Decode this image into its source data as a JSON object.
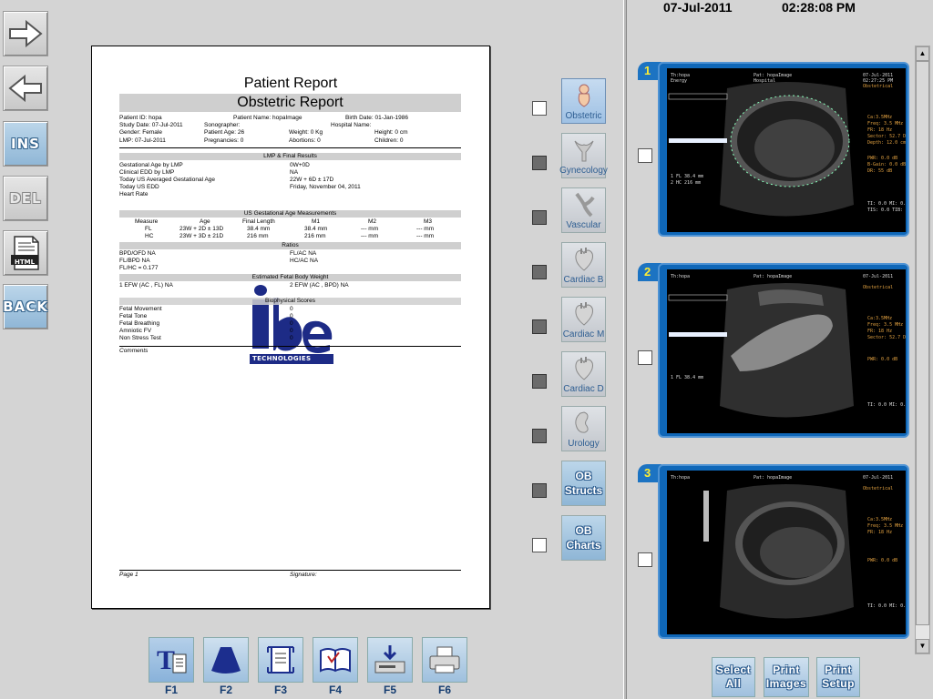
{
  "left_toolbar": {
    "forward_label": "",
    "back_arrow_label": "",
    "ins_label": "INS",
    "del_label": "DEL",
    "html_label": "HTML",
    "back_label": "BACK"
  },
  "report": {
    "title": "Patient Report",
    "subtitle": "Obstetric Report",
    "patient": {
      "patient_id": "Patient ID: hopa",
      "patient_name": "Patient Name: hopaImage",
      "birth_date": "Birth Date: 01-Jan-1986",
      "study_date": "Study Date: 07-Jul-2011",
      "sonographer": "Sonographer:",
      "hospital_name": "Hospital Name:",
      "gender": "Gender: Female",
      "patient_age": "Patient Age: 26",
      "weight": "Weight: 0 Kg",
      "height": "Height: 0 cm",
      "lmp": "LMP: 07-Jul-2011",
      "pregnancies": "Pregnancies: 0",
      "abortions": "Abortions: 0",
      "children": "Children: 0"
    },
    "lmp_section": {
      "header": "LMP & Final Results",
      "rows": [
        {
          "label": "Gestational Age by LMP",
          "value": "0W+0D"
        },
        {
          "label": "Clinical EDD by LMP",
          "value": "NA"
        },
        {
          "label": "Today US Averaged Gestational Age",
          "value": "22W + 6D ± 17D"
        },
        {
          "label": "Today US EDD",
          "value": "Friday, November 04, 2011"
        },
        {
          "label": "Heart Rate",
          "value": ""
        }
      ]
    },
    "us_section": {
      "header": "US Gestational Age Measurements",
      "columns": [
        "Measure",
        "Age",
        "Final Length",
        "M1",
        "M2",
        "M3"
      ],
      "rows": [
        [
          "FL",
          "23W + 2D ± 13D",
          "38.4 mm",
          "38.4 mm",
          "--- mm",
          "--- mm"
        ],
        [
          "HC",
          "23W + 3D ± 21D",
          "216 mm",
          "216 mm",
          "--- mm",
          "--- mm"
        ]
      ]
    },
    "ratios": {
      "header": "Ratios",
      "left": [
        "BPD/OFD NA",
        "FL/BPD NA",
        "FL/HC = 0.177"
      ],
      "right": [
        "FL/AC NA",
        "HC/AC NA"
      ]
    },
    "efw": {
      "header": "Estimated Fetal Body Weight",
      "left": "1 EFW (AC , FL) NA",
      "right": "2 EFW (AC , BPD) NA"
    },
    "biophysical": {
      "header": "Biophysical Scores",
      "rows": [
        {
          "label": "Fetal Movement",
          "value": "0"
        },
        {
          "label": "Fetal Tone",
          "value": "0"
        },
        {
          "label": "Fetal Breathing",
          "value": "0"
        },
        {
          "label": "Amniotic FV",
          "value": "0"
        },
        {
          "label": "Non Stress Test",
          "value": "0"
        }
      ]
    },
    "comments": "Comments",
    "logo_text": "TECHNOLOGIES",
    "footer_page": "Page 1",
    "footer_signature": "Signature:"
  },
  "exams": [
    {
      "label": "Obstetric",
      "icon": "fetus-icon",
      "checked": false,
      "active": true
    },
    {
      "label": "Gynecology",
      "icon": "uterus-icon",
      "checked": true,
      "active": false
    },
    {
      "label": "Vascular",
      "icon": "vessel-icon",
      "checked": true,
      "active": false
    },
    {
      "label": "Cardiac B",
      "icon": "heart-icon",
      "checked": true,
      "active": false
    },
    {
      "label": "Cardiac M",
      "icon": "heart-icon",
      "checked": true,
      "active": false
    },
    {
      "label": "Cardiac D",
      "icon": "heart-icon",
      "checked": true,
      "active": false
    },
    {
      "label": "Urology",
      "icon": "kidney-icon",
      "checked": true,
      "active": false
    },
    {
      "label": "OB Structs",
      "icon": "",
      "checked": true,
      "active": false
    },
    {
      "label": "OB Charts",
      "icon": "",
      "checked": false,
      "active": false
    }
  ],
  "right_panel": {
    "date": "07-Jul-2011",
    "time": "02:28:08 PM",
    "thumbnails": [
      {
        "index": "1"
      },
      {
        "index": "2"
      },
      {
        "index": "3"
      }
    ],
    "buttons": {
      "select_all": "Select All",
      "print_images": "Print Images",
      "print_setup": "Print Setup"
    }
  },
  "function_keys": [
    {
      "key": "F1",
      "icon": "text-report-icon"
    },
    {
      "key": "F2",
      "icon": "probe-sector-icon"
    },
    {
      "key": "F3",
      "icon": "document-scan-icon"
    },
    {
      "key": "F4",
      "icon": "open-book-icon"
    },
    {
      "key": "F5",
      "icon": "save-drive-icon"
    },
    {
      "key": "F6",
      "icon": "printer-icon"
    }
  ]
}
